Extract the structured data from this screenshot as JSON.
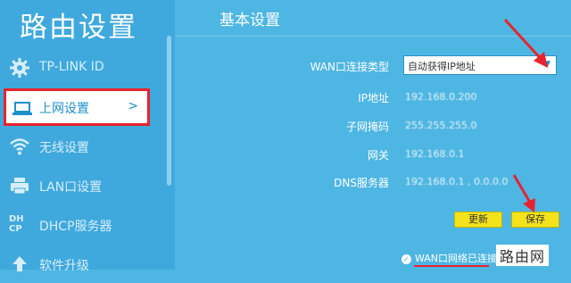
{
  "sidebar": {
    "title": "路由设置",
    "items": [
      {
        "label": "TP-LINK ID",
        "icon": "gear-icon"
      },
      {
        "label": "上网设置",
        "icon": "laptop-icon",
        "arrow": ">"
      },
      {
        "label": "无线设置",
        "icon": "wifi-icon"
      },
      {
        "label": "LAN口设置",
        "icon": "printer-icon"
      },
      {
        "label": "DHCP服务器",
        "icon": "dhcp-icon",
        "icon_text": "DH\nCP"
      },
      {
        "label": "软件升级",
        "icon": "upload-icon"
      }
    ]
  },
  "main": {
    "title": "基本设置",
    "wan_type": {
      "label": "WAN口连接类型",
      "value": "自动获得IP地址"
    },
    "ip": {
      "label": "IP地址",
      "value": "192.168.0.200"
    },
    "mask": {
      "label": "子网掩码",
      "value": "255.255.255.0"
    },
    "gateway": {
      "label": "网关",
      "value": "192.168.0.1"
    },
    "dns": {
      "label": "DNS服务器",
      "value": "192.168.0.1 , 0.0.0.0"
    },
    "refresh_label": "更新",
    "save_label": "保存",
    "status": "WAN口网络已连接"
  },
  "watermark": "路由网",
  "colors": {
    "accent": "#3fa9dd",
    "highlight": "#e8232d",
    "button": "#f4e21b"
  }
}
